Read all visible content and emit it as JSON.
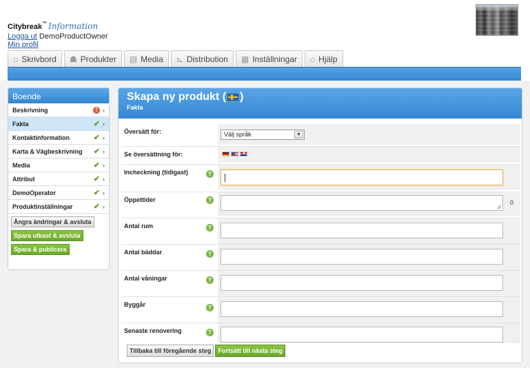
{
  "header": {
    "brand": "Citybreak",
    "brand_tm": "™",
    "brand_script": "Information",
    "logout_link": "Logga ut",
    "username": "DemoProductOwner",
    "profile_link": "Min profil"
  },
  "tabs": [
    {
      "label": "Skrivbord",
      "icon": "home-icon"
    },
    {
      "label": "Produkter",
      "icon": "people-icon"
    },
    {
      "label": "Media",
      "icon": "film-icon"
    },
    {
      "label": "Distribution",
      "icon": "chart-icon"
    },
    {
      "label": "Inställningar",
      "icon": "list-icon"
    },
    {
      "label": "Hjälp",
      "icon": "home-icon"
    }
  ],
  "sidebar": {
    "title": "Boende",
    "items": [
      {
        "label": "Beskrivning",
        "status": "warning"
      },
      {
        "label": "Fakta",
        "status": "ok"
      },
      {
        "label": "Kontaktinformation",
        "status": "ok"
      },
      {
        "label": "Karta & Vägbeskrivning",
        "status": "ok"
      },
      {
        "label": "Media",
        "status": "ok"
      },
      {
        "label": "Attribut",
        "status": "ok"
      },
      {
        "label": "DemoOperator",
        "status": "ok"
      },
      {
        "label": "Produktinställningar",
        "status": "ok"
      }
    ],
    "buttons": {
      "cancel": "Ångra ändringar & avsluta",
      "save_draft": "Spara utkast & avsluta",
      "save_publish": "Spara & publicera"
    }
  },
  "main": {
    "title": "Skapa ny produkt (",
    "title_end": ")",
    "subtitle": "Fakta",
    "translate_label": "Översätt för:",
    "language_select": "Välj språk",
    "see_translation_label": "Se översättning för:",
    "fields": [
      {
        "label": "Incheckning (tidigast)",
        "value": ""
      },
      {
        "label": "Öppettider",
        "value": "",
        "counter": "0"
      },
      {
        "label": "Antal rum",
        "value": ""
      },
      {
        "label": "Antal bäddar",
        "value": ""
      },
      {
        "label": "Antal våningar",
        "value": ""
      },
      {
        "label": "Byggår",
        "value": ""
      },
      {
        "label": "Senaste renovering",
        "value": ""
      }
    ],
    "buttons": {
      "back": "Tillbaka till föregående steg",
      "next": "Fortsätt till nästa steg"
    }
  },
  "colors": {
    "accent_blue": "#3887d0",
    "green": "#7ab648",
    "warning": "#e05a3a"
  }
}
